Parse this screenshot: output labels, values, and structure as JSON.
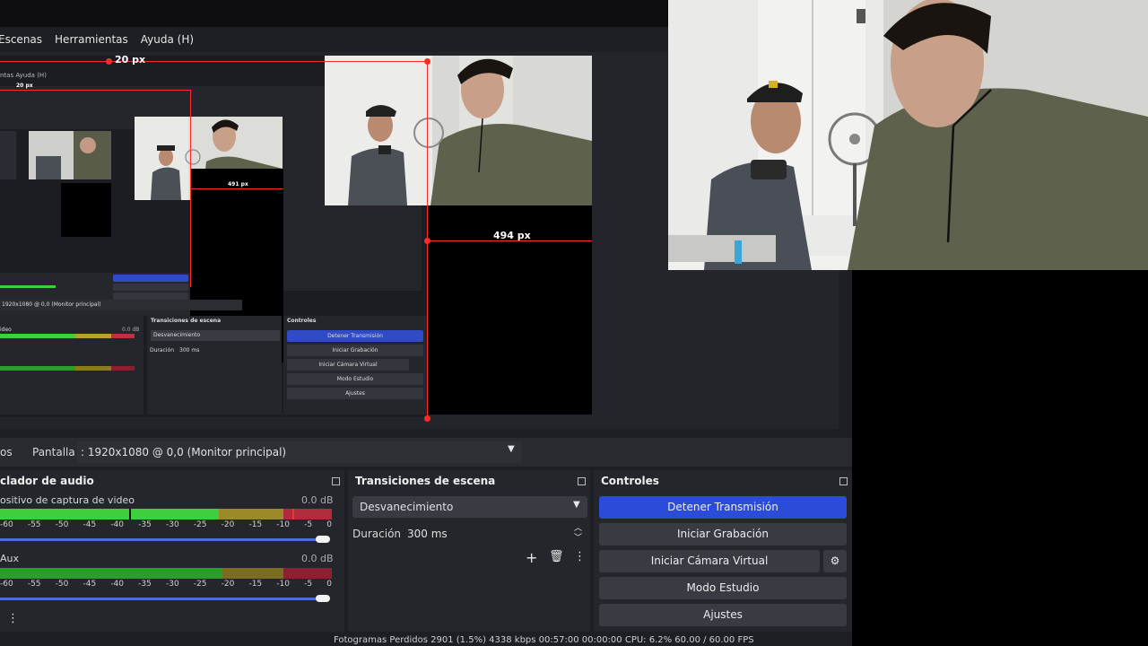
{
  "menu": [
    "Escenas",
    "Herramientas",
    "Ayuda (H)"
  ],
  "measurements": {
    "top": "20 px",
    "right": "494 px",
    "inner_top": "20 px",
    "inner_right": "491 px"
  },
  "source_bar": {
    "label": "Pantalla",
    "value": ": 1920x1080 @ 0,0 (Monitor principal)",
    "left_fragment": "os"
  },
  "audio": {
    "title": "clador de audio",
    "channels": [
      {
        "name": "ositivo de captura de video",
        "db": "0.0 dB"
      },
      {
        "name": "Aux",
        "db": "0.0 dB"
      }
    ],
    "ticks": [
      "-60",
      "-55",
      "-50",
      "-45",
      "-40",
      "-35",
      "-30",
      "-25",
      "-20",
      "-15",
      "-10",
      "-5",
      "0"
    ]
  },
  "transitions": {
    "title": "Transiciones de escena",
    "selected": "Desvanecimiento",
    "duration_label": "Duración",
    "duration_value": "300 ms"
  },
  "controls": {
    "title": "Controles",
    "buttons": [
      "Detener Transmisión",
      "Iniciar Grabación",
      "Iniciar Cámara Virtual",
      "Modo Estudio",
      "Ajustes"
    ]
  },
  "inner": {
    "menu": "ntas   Ayuda (H)",
    "source": "1920x1080 @ 0,0 (Monitor principal)",
    "trans_title": "Transiciones de escena",
    "ctrl_title": "Controles",
    "trans_selected": "Desvanecimiento",
    "duration_label": "Duración",
    "duration_value": "300 ms",
    "db": "0.0 dB",
    "channel": "ideo",
    "buttons": [
      "Detener Transmisión",
      "Iniciar Grabación",
      "Iniciar Cámara Virtual",
      "Modo Estudio",
      "Ajustes"
    ]
  },
  "status": "Fotogramas Perdidos 2901 (1.5%)    4338 kbps    00:57:00    00:00:00    CPU: 6.2%    60.00 / 60.00 FPS",
  "colors": {
    "accent": "#2b4cd9",
    "measure": "#ff2a2a",
    "meter_green": "#3ecf3e",
    "meter_yellow": "#b8a12a",
    "meter_red": "#c23040"
  }
}
